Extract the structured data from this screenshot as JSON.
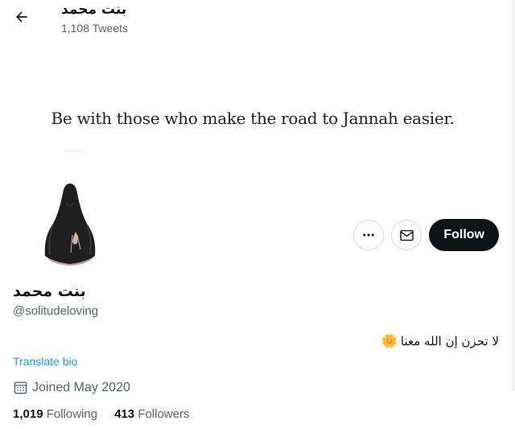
{
  "header": {
    "name": "بنت محمد",
    "tweet_count": "1,108 Tweets"
  },
  "banner": {
    "quote": "Be with those who make the road to Jannah easier."
  },
  "actions": {
    "follow_label": "Follow",
    "more_icon": "more-icon",
    "message_icon": "envelope-icon"
  },
  "profile": {
    "display_name": "بنت محمد",
    "handle": "@solitudeloving",
    "bio": "لا تحزن إن الله معنا",
    "bio_emoji": "🌼",
    "translate_label": "Translate bio",
    "joined": "Joined May 2020",
    "following_count": "1,019",
    "following_label": "Following",
    "followers_count": "413",
    "followers_label": "Followers"
  },
  "colors": {
    "accent": "#1d9bf0",
    "text_primary": "#0f1419",
    "text_secondary": "#536471",
    "follow_bg": "#0f1419"
  }
}
